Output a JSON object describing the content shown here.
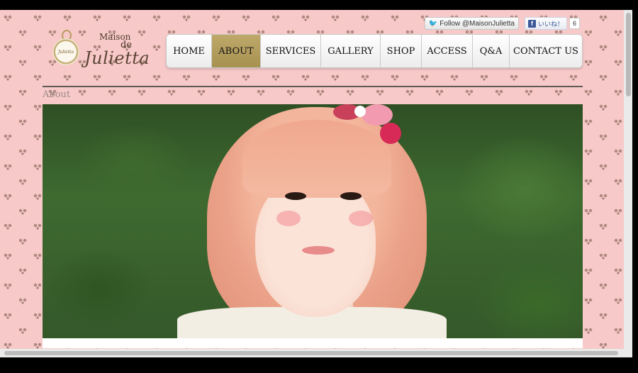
{
  "social": {
    "twitter_label": "Follow @MaisonJulietta",
    "facebook_label": "いいね！",
    "facebook_count": "6"
  },
  "logo": {
    "line1": "Maison",
    "line2": "de",
    "line3": "Julietta",
    "watch_text": "Julietta"
  },
  "nav": {
    "items": [
      {
        "label": "HOME",
        "active": false
      },
      {
        "label": "ABOUT",
        "active": true
      },
      {
        "label": "SERVICES",
        "active": false
      },
      {
        "label": "GALLERY",
        "active": false
      },
      {
        "label": "SHOP",
        "active": false
      },
      {
        "label": "ACCESS",
        "active": false
      },
      {
        "label": "Q&A",
        "active": false
      },
      {
        "label": "CONTACT US",
        "active": false
      }
    ]
  },
  "breadcrumb": "About",
  "colors": {
    "background_pink": "#f8c9c9",
    "active_tab": "#b09a5c",
    "rule": "#5e5a57"
  }
}
